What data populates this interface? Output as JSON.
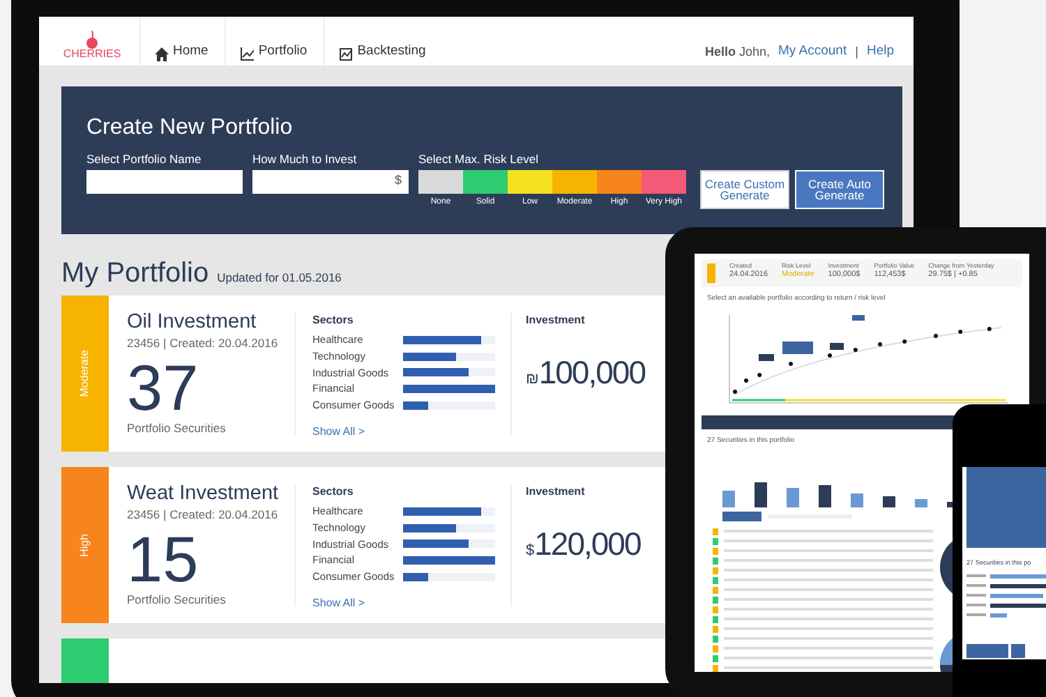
{
  "brand": {
    "name": "CHERRIES"
  },
  "nav": [
    {
      "label": "Home",
      "kind": "home"
    },
    {
      "label": "Portfolio",
      "kind": "chart"
    },
    {
      "label": "Backtesting",
      "kind": "board"
    }
  ],
  "user": {
    "greeting": "**Hello** John,",
    "links": [
      "My Account",
      "Help"
    ],
    "separator": "|"
  },
  "create_panel": {
    "title": "Create New Portfolio",
    "fields": [
      {
        "label": "Select Portfolio Name"
      },
      {
        "label": "How Much to Invest",
        "suffix": "$"
      }
    ],
    "risk": {
      "label": "Select Max. Risk Level",
      "levels": [
        {
          "name": "None",
          "color": "#d9d9d9"
        },
        {
          "name": "Solid",
          "color": "#2ecc71"
        },
        {
          "name": "Low",
          "color": "#f4e11f"
        },
        {
          "name": "Moderate",
          "color": "#f6b400"
        },
        {
          "name": "High",
          "color": "#f7841c"
        },
        {
          "name": "Very High",
          "color": "#f25a78"
        }
      ]
    },
    "buttons": [
      {
        "label": "Create Custom Generate",
        "kind": "outline"
      },
      {
        "label": "Create Auto Generate",
        "kind": "primary"
      }
    ]
  },
  "portfolio": {
    "title": "My Portfolio",
    "updated": "Updated for 01.05.2016",
    "cards": [
      {
        "risk": "Moderate",
        "color": "#f6b400",
        "name": "Oil Investment",
        "meta": "23456 | Created: 20.04.2016",
        "count": "37",
        "count_label": "Portfolio Securities",
        "sectors_title": "Sectors",
        "sectors": [
          {
            "name": "Healthcare",
            "level": 0.85
          },
          {
            "name": "Technology",
            "level": 0.57
          },
          {
            "name": "Industrial Goods",
            "level": 0.71
          },
          {
            "name": "Financial",
            "level": 1
          },
          {
            "name": "Consumer Goods",
            "level": 0.28
          }
        ],
        "show_all": "Show All >",
        "investment_title": "Investment",
        "currency": "₪",
        "amount": "100,000"
      },
      {
        "risk": "High",
        "color": "#f7841c",
        "name": "Weat Investment",
        "meta": "23456 | Created: 20.04.2016",
        "count": "15",
        "count_label": "Portfolio Securities",
        "sectors_title": "Sectors",
        "sectors": [
          {
            "name": "Healthcare",
            "level": 0.85
          },
          {
            "name": "Technology",
            "level": 0.57
          },
          {
            "name": "Industrial Goods",
            "level": 0.71
          },
          {
            "name": "Financial",
            "level": 1
          },
          {
            "name": "Consumer Goods",
            "level": 0.28
          }
        ],
        "show_all": "Show All >",
        "investment_title": "Investment",
        "currency": "$",
        "amount": "120,000"
      },
      {
        "color": "#2ecc71"
      }
    ]
  },
  "tablet": {
    "stats": [
      {
        "label": "Created",
        "value": "24.04.2016"
      },
      {
        "label": "Risk Level",
        "value": "Moderate"
      },
      {
        "label": "Investment",
        "value": "100,000$"
      },
      {
        "label": "Portfolio Value",
        "value": "112,453$"
      },
      {
        "label": "Change from Yesterday",
        "value": "29.75$ | +0.85"
      }
    ],
    "chart_title": "Select an available portfolio according to return / risk level",
    "securities_title": "27 Securities in this portfolio"
  },
  "phone": {
    "securities_title": "27 Securities in this po"
  }
}
